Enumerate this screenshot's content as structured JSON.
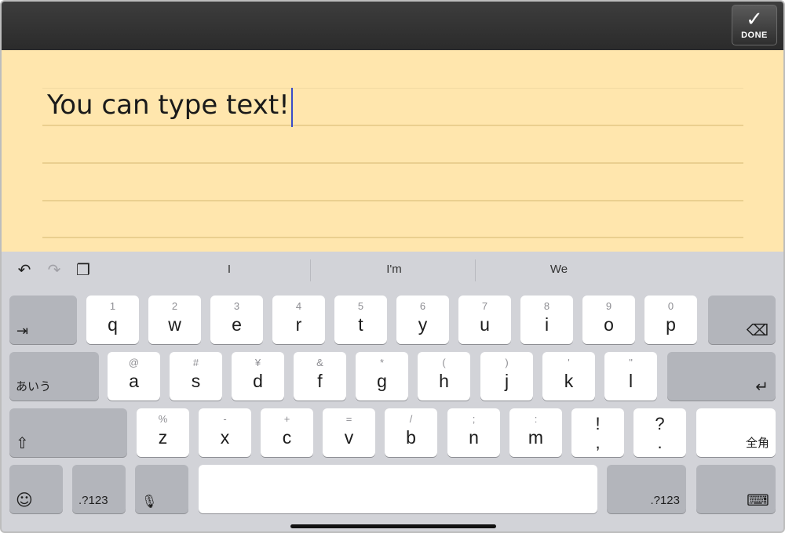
{
  "topbar": {
    "done_icon": "✓",
    "done_label": "DONE"
  },
  "note": {
    "text": "You can type text!"
  },
  "toolbar": {
    "undo_icon": "↶",
    "redo_icon": "↷",
    "paste_icon": "❐"
  },
  "suggestions": [
    "I",
    "I'm",
    "We"
  ],
  "keys": {
    "row1": [
      {
        "hint": "1",
        "main": "q"
      },
      {
        "hint": "2",
        "main": "w"
      },
      {
        "hint": "3",
        "main": "e"
      },
      {
        "hint": "4",
        "main": "r"
      },
      {
        "hint": "5",
        "main": "t"
      },
      {
        "hint": "6",
        "main": "y"
      },
      {
        "hint": "7",
        "main": "u"
      },
      {
        "hint": "8",
        "main": "i"
      },
      {
        "hint": "9",
        "main": "o"
      },
      {
        "hint": "0",
        "main": "p"
      }
    ],
    "row2": [
      {
        "hint": "@",
        "main": "a"
      },
      {
        "hint": "#",
        "main": "s"
      },
      {
        "hint": "¥",
        "main": "d"
      },
      {
        "hint": "&",
        "main": "f"
      },
      {
        "hint": "*",
        "main": "g"
      },
      {
        "hint": "(",
        "main": "h"
      },
      {
        "hint": ")",
        "main": "j"
      },
      {
        "hint": "'",
        "main": "k"
      },
      {
        "hint": "\"",
        "main": "l"
      }
    ],
    "row3": [
      {
        "hint": "%",
        "main": "z"
      },
      {
        "hint": "-",
        "main": "x"
      },
      {
        "hint": "+",
        "main": "c"
      },
      {
        "hint": "=",
        "main": "v"
      },
      {
        "hint": "/",
        "main": "b"
      },
      {
        "hint": ";",
        "main": "n"
      },
      {
        "hint": ":",
        "main": "m"
      },
      {
        "hint": "!",
        "main": ","
      },
      {
        "hint": "?",
        "main": "."
      }
    ],
    "tab_icon": "⇥",
    "delete_icon": "⌫",
    "kana_label": "あいう",
    "return_icon": "↵",
    "shift_icon": "⇧",
    "zenkaku_label": "全角",
    "emoji_icon": "☺",
    "numbers_label": ".?123",
    "mic_icon": "🎙",
    "dismiss_icon": "⌨"
  }
}
